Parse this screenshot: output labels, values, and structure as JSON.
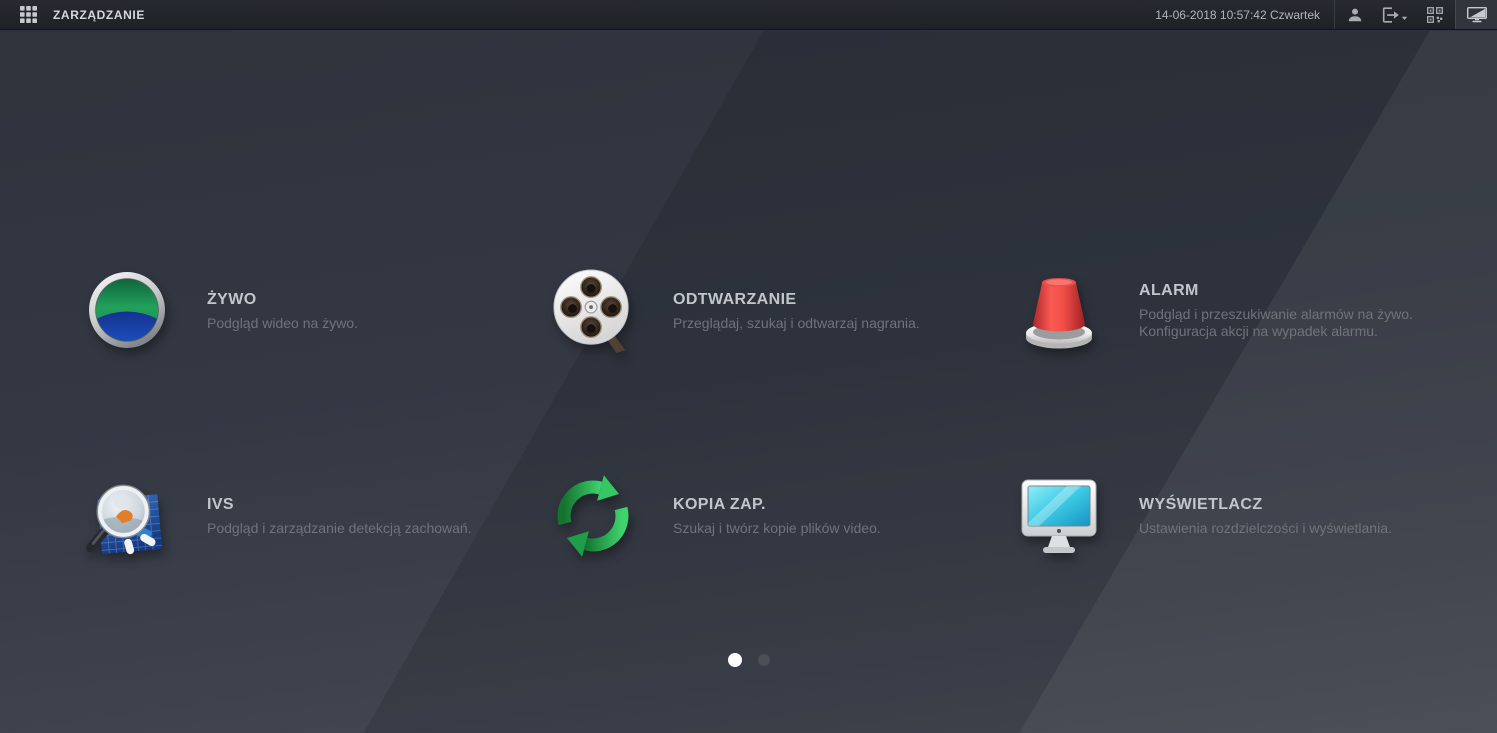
{
  "topbar": {
    "title": "ZARZĄDZANIE",
    "datetime": "14-06-2018 10:57:42 Czwartek",
    "icons": [
      "apps-grid-icon",
      "user-icon",
      "logout-icon",
      "qr-code-icon",
      "display-toggle-icon"
    ]
  },
  "menu": {
    "items": [
      {
        "id": "zywo",
        "title": "ŻYWO",
        "desc": "Podgląd wideo na żywo.",
        "icon": "live-view-icon"
      },
      {
        "id": "odtwarzanie",
        "title": "ODTWARZANIE",
        "desc": "Przeglądaj, szukaj i odtwarzaj nagrania.",
        "icon": "playback-icon"
      },
      {
        "id": "alarm",
        "title": "ALARM",
        "desc": "Podgląd i przeszukiwanie alarmów na żywo.",
        "desc2": "Konfiguracja akcji na wypadek alarmu.",
        "icon": "alarm-siren-icon"
      },
      {
        "id": "ivs",
        "title": "IVS",
        "desc": "Podgląd i zarządzanie detekcją zachowań.",
        "icon": "ivs-magnifier-icon"
      },
      {
        "id": "kopia-zap",
        "title": "KOPIA ZAP.",
        "desc": "Szukaj i twórz kopie plików video.",
        "icon": "backup-sync-icon"
      },
      {
        "id": "wyswietlacz",
        "title": "WYŚWIETLACZ",
        "desc": "Ustawienia rozdzielczości i wyświetlania.",
        "icon": "display-monitor-icon"
      }
    ]
  },
  "pagination": {
    "total_pages": 2,
    "active_page": 1
  },
  "colors": {
    "topbar_bg": "#22252b",
    "background": "#343842",
    "title_text": "#c2c6cc",
    "desc_text": "#6f737b",
    "dot_active": "#ffffff",
    "dot_inactive": "#4a4e56",
    "alarm_red": "#ef4a45",
    "backup_green": "#2eb558",
    "live_green": "#219a58",
    "live_blue": "#1c50c0",
    "screen_cyan": "#3cc8e4"
  }
}
